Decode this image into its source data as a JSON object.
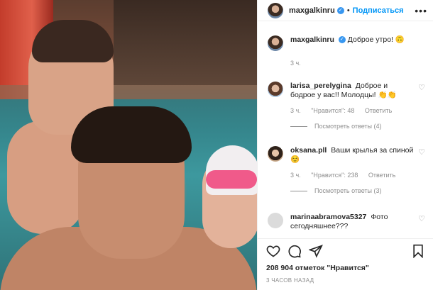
{
  "post": {
    "username": "maxgalkinru",
    "follow_label": "Подписаться",
    "verified_icon": "verified-check-icon",
    "more_icon": "more-options-icon",
    "photo": "photo of a man in a pool with two children"
  },
  "caption": {
    "username": "maxgalkinru",
    "text": "Доброе утро! 🙃",
    "time": "3 ч."
  },
  "comments": [
    {
      "username": "larisa_perelygina",
      "text": "Доброе и бодрое у вас!! Молодцы! 👏👏",
      "time": "3 ч.",
      "likes": "\"Нравится\": 48",
      "reply": "Ответить",
      "view_replies": "Посмотреть ответы (4)"
    },
    {
      "username": "oksana.pll",
      "text": "Ваши крылья за спиной☺️",
      "time": "3 ч.",
      "likes": "\"Нравится\": 238",
      "reply": "Ответить",
      "view_replies": "Посмотреть ответы (3)"
    },
    {
      "username": "marinaabramova5327",
      "text": "Фото сегодняшнее???",
      "time": "",
      "likes": "",
      "reply": "",
      "view_replies": ""
    }
  ],
  "actions": {
    "likes_text": "208 904 отметок \"Нравится\"",
    "posted_ago": "3 ЧАСОВ НАЗАД",
    "icons": [
      "heart-icon",
      "comment-icon",
      "share-icon",
      "bookmark-icon"
    ]
  },
  "colors": {
    "accent": "#0095f6",
    "verified": "#3897f0",
    "muted": "#8e8e8e",
    "border": "#efefef"
  }
}
